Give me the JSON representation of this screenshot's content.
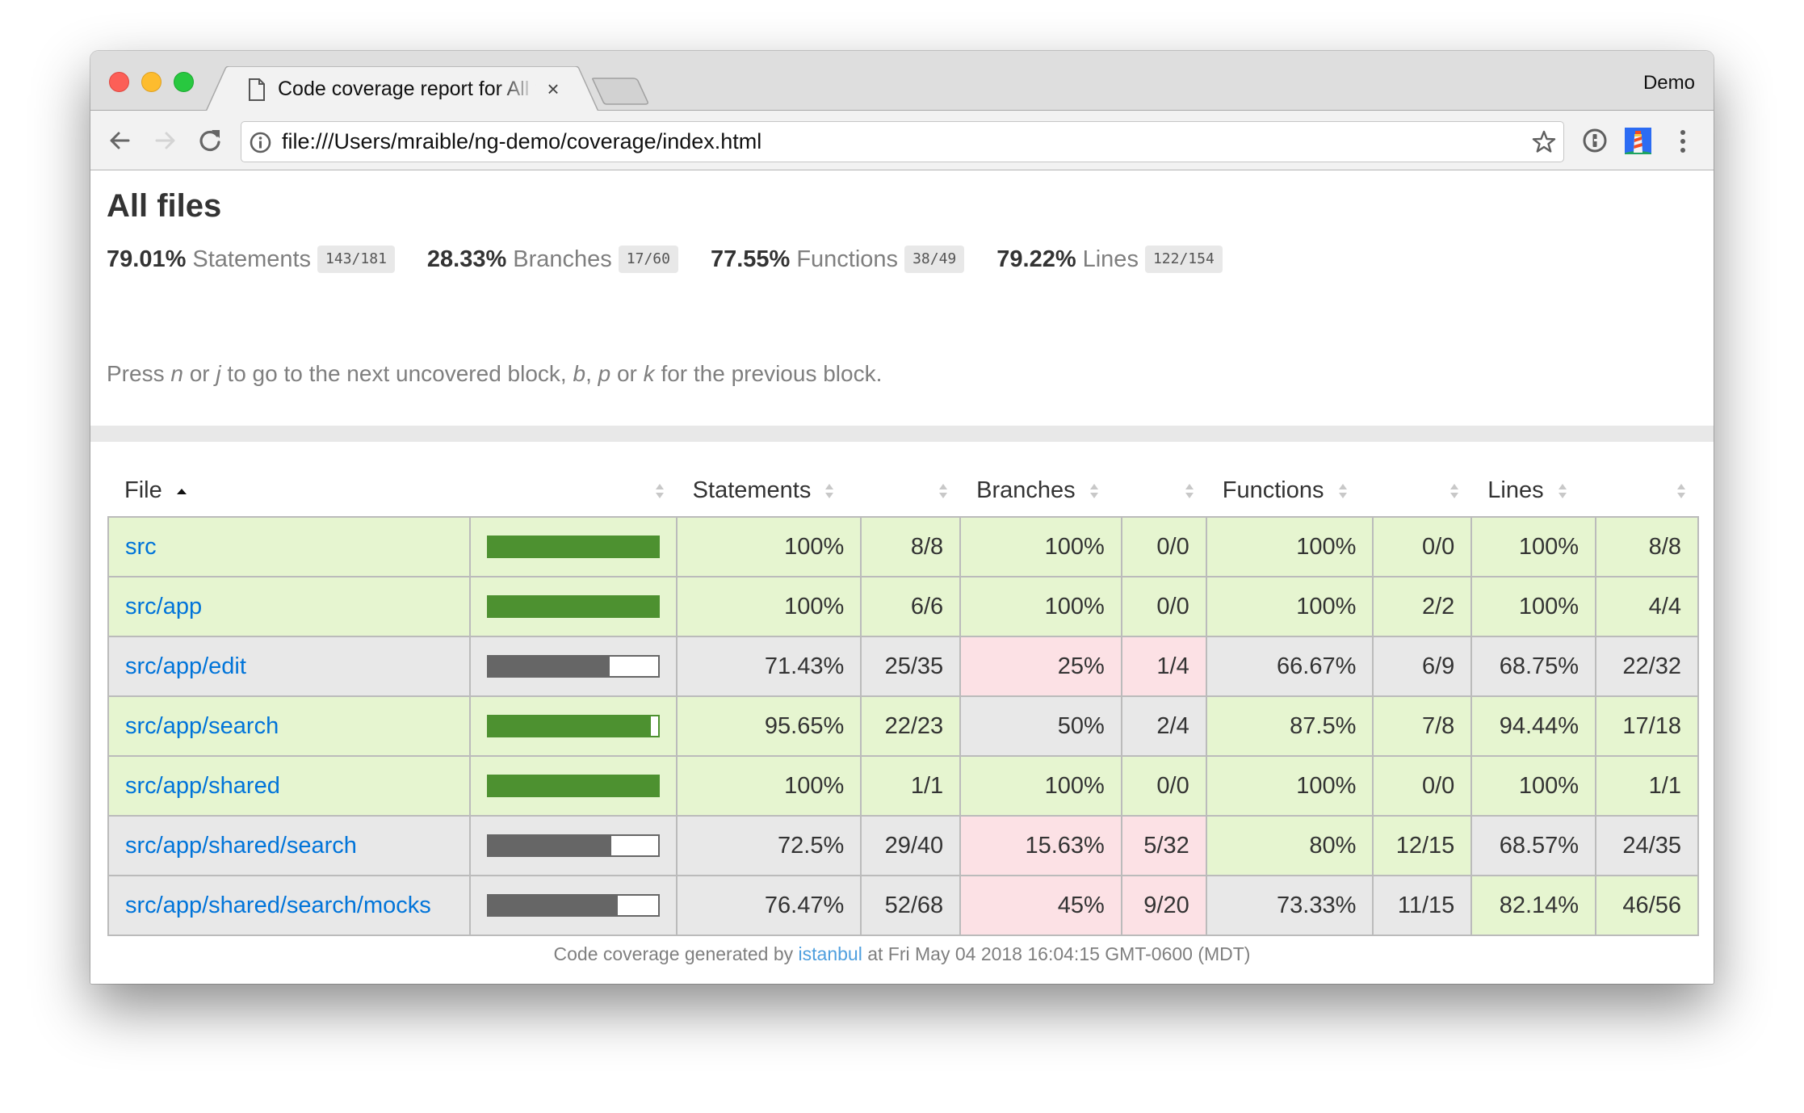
{
  "browser": {
    "tab_title": "Code coverage report for All files",
    "profile_name": "Demo",
    "url": "file:///Users/mraible/ng-demo/coverage/index.html",
    "icons": {
      "back": "arrow-left-icon",
      "forward": "arrow-right-icon",
      "reload": "reload-icon",
      "info": "info-icon",
      "bookmark": "star-icon",
      "password_manager": "1password-icon",
      "lighthouse": "lighthouse-icon",
      "menu": "kebab-menu-icon"
    }
  },
  "page": {
    "title": "All files",
    "summary": [
      {
        "pct": "79.01%",
        "label": "Statements",
        "fraction": "143/181"
      },
      {
        "pct": "28.33%",
        "label": "Branches",
        "fraction": "17/60"
      },
      {
        "pct": "77.55%",
        "label": "Functions",
        "fraction": "38/49"
      },
      {
        "pct": "79.22%",
        "label": "Lines",
        "fraction": "122/154"
      }
    ],
    "hint": {
      "p1": "Press ",
      "k1": "n",
      "p2": " or ",
      "k2": "j",
      "p3": " to go to the next uncovered block, ",
      "k3": "b",
      "p4": ", ",
      "k4": "p",
      "p5": " or ",
      "k5": "k",
      "p6": " for the previous block."
    },
    "footer": {
      "prefix": "Code coverage generated by ",
      "link": "istanbul",
      "suffix": " at Fri May 04 2018 16:04:15 GMT-0600 (MDT)"
    }
  },
  "table": {
    "headers": {
      "file": "File",
      "statements": "Statements",
      "branches": "Branches",
      "functions": "Functions",
      "lines": "Lines"
    },
    "sort": {
      "column": "File",
      "direction": "ascending"
    },
    "colors": {
      "high_bg": "#e6f5d0",
      "medium_bg": "#e8e8e8",
      "low_bg": "#fce1e5",
      "bar_high": "#4d9130",
      "bar_medium": "#666666",
      "link": "#0074d9"
    },
    "rows": [
      {
        "file": "src",
        "bar_pct": 100,
        "bar_level": "high",
        "statements": {
          "pct": "100%",
          "fraction": "8/8",
          "level": "high"
        },
        "branches": {
          "pct": "100%",
          "fraction": "0/0",
          "level": "high"
        },
        "functions": {
          "pct": "100%",
          "fraction": "0/0",
          "level": "high"
        },
        "lines": {
          "pct": "100%",
          "fraction": "8/8",
          "level": "high"
        }
      },
      {
        "file": "src/app",
        "bar_pct": 100,
        "bar_level": "high",
        "statements": {
          "pct": "100%",
          "fraction": "6/6",
          "level": "high"
        },
        "branches": {
          "pct": "100%",
          "fraction": "0/0",
          "level": "high"
        },
        "functions": {
          "pct": "100%",
          "fraction": "2/2",
          "level": "high"
        },
        "lines": {
          "pct": "100%",
          "fraction": "4/4",
          "level": "high"
        }
      },
      {
        "file": "src/app/edit",
        "bar_pct": 71.43,
        "bar_level": "medium",
        "statements": {
          "pct": "71.43%",
          "fraction": "25/35",
          "level": "medium"
        },
        "branches": {
          "pct": "25%",
          "fraction": "1/4",
          "level": "low"
        },
        "functions": {
          "pct": "66.67%",
          "fraction": "6/9",
          "level": "medium"
        },
        "lines": {
          "pct": "68.75%",
          "fraction": "22/32",
          "level": "medium"
        }
      },
      {
        "file": "src/app/search",
        "bar_pct": 95.65,
        "bar_level": "high",
        "statements": {
          "pct": "95.65%",
          "fraction": "22/23",
          "level": "high"
        },
        "branches": {
          "pct": "50%",
          "fraction": "2/4",
          "level": "medium"
        },
        "functions": {
          "pct": "87.5%",
          "fraction": "7/8",
          "level": "high"
        },
        "lines": {
          "pct": "94.44%",
          "fraction": "17/18",
          "level": "high"
        }
      },
      {
        "file": "src/app/shared",
        "bar_pct": 100,
        "bar_level": "high",
        "statements": {
          "pct": "100%",
          "fraction": "1/1",
          "level": "high"
        },
        "branches": {
          "pct": "100%",
          "fraction": "0/0",
          "level": "high"
        },
        "functions": {
          "pct": "100%",
          "fraction": "0/0",
          "level": "high"
        },
        "lines": {
          "pct": "100%",
          "fraction": "1/1",
          "level": "high"
        }
      },
      {
        "file": "src/app/shared/search",
        "bar_pct": 72.5,
        "bar_level": "medium",
        "statements": {
          "pct": "72.5%",
          "fraction": "29/40",
          "level": "medium"
        },
        "branches": {
          "pct": "15.63%",
          "fraction": "5/32",
          "level": "low"
        },
        "functions": {
          "pct": "80%",
          "fraction": "12/15",
          "level": "high"
        },
        "lines": {
          "pct": "68.57%",
          "fraction": "24/35",
          "level": "medium"
        }
      },
      {
        "file": "src/app/shared/search/mocks",
        "bar_pct": 76.47,
        "bar_level": "medium",
        "statements": {
          "pct": "76.47%",
          "fraction": "52/68",
          "level": "medium"
        },
        "branches": {
          "pct": "45%",
          "fraction": "9/20",
          "level": "low"
        },
        "functions": {
          "pct": "73.33%",
          "fraction": "11/15",
          "level": "medium"
        },
        "lines": {
          "pct": "82.14%",
          "fraction": "46/56",
          "level": "high"
        }
      }
    ]
  }
}
